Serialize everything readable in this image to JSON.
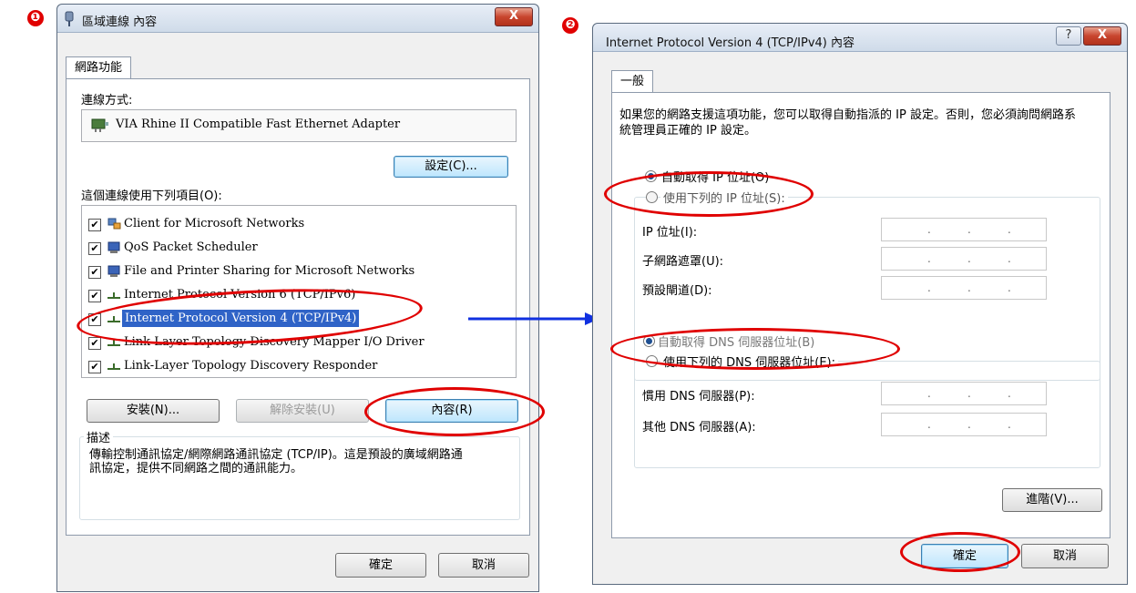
{
  "steps": {
    "one": "❶",
    "two": "❷"
  },
  "colors": {
    "annotation": "#e00000",
    "arrow": "#1030e0",
    "selection": "#2f63c7"
  },
  "left_window": {
    "title": "區域連線 內容",
    "close_glyph": "X",
    "tab": "網路功能",
    "connect_using_label": "連線方式:",
    "adapter_name": "VIA Rhine II Compatible Fast Ethernet Adapter",
    "configure_button": "設定(C)...",
    "items_label": "這個連線使用下列項目(O):",
    "items": [
      {
        "label": "Client for Microsoft Networks",
        "checked": true,
        "icon": "network-client-icon"
      },
      {
        "label": "QoS Packet Scheduler",
        "checked": true,
        "icon": "scheduler-icon"
      },
      {
        "label": "File and Printer Sharing for Microsoft Networks",
        "checked": true,
        "icon": "file-sharing-icon"
      },
      {
        "label": "Internet Protocol Version 6 (TCP/IPv6)",
        "checked": true,
        "icon": "protocol-icon"
      },
      {
        "label": "Internet Protocol Version 4 (TCP/IPv4)",
        "checked": true,
        "icon": "protocol-icon",
        "selected": true
      },
      {
        "label": "Link-Layer Topology Discovery Mapper I/O Driver",
        "checked": true,
        "icon": "protocol-icon"
      },
      {
        "label": "Link-Layer Topology Discovery Responder",
        "checked": true,
        "icon": "protocol-icon"
      }
    ],
    "install_button": "安裝(N)...",
    "uninstall_button": "解除安裝(U)",
    "properties_button": "內容(R)",
    "description_label": "描述",
    "description_text": "傳輸控制通訊協定/網際網路通訊協定 (TCP/IP)。這是預設的廣域網路通訊協定，提供不同網路之間的通訊能力。",
    "ok_button": "確定",
    "cancel_button": "取消"
  },
  "right_window": {
    "title": "Internet Protocol Version 4 (TCP/IPv4) 內容",
    "help_glyph": "?",
    "close_glyph": "X",
    "tab": "一般",
    "intro_text": "如果您的網路支援這項功能，您可以取得自動指派的 IP 設定。否則，您必須詢問網路系統管理員正確的 IP 設定。",
    "auto_ip_label": "自動取得 IP 位址(O)",
    "manual_ip_label": "使用下列的 IP 位址(S):",
    "ip_address_label": "IP 位址(I):",
    "subnet_label": "子網路遮罩(U):",
    "gateway_label": "預設閘道(D):",
    "auto_dns_label": "自動取得 DNS 伺服器位址(B)",
    "manual_dns_label": "使用下列的 DNS 伺服器位址(E):",
    "preferred_dns_label": "慣用 DNS 伺服器(P):",
    "alternate_dns_label": "其他 DNS 伺服器(A):",
    "ip_dot": ".",
    "advanced_button": "進階(V)...",
    "ok_button": "確定",
    "cancel_button": "取消"
  }
}
